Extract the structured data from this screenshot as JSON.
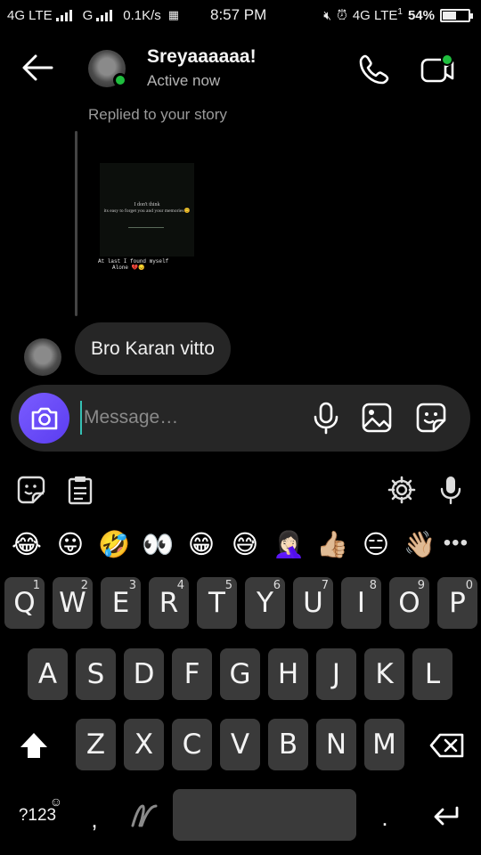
{
  "status_bar": {
    "network1": "4G LTE",
    "network2": "G",
    "speed": "0.1K/s",
    "time": "8:57 PM",
    "network3": "4G LTE",
    "network3_sub": "1",
    "battery": "54%",
    "battery_level": 0.54
  },
  "header": {
    "contact_name": "Sreyaaaaaa!",
    "status": "Active now"
  },
  "chat": {
    "replied_label": "Replied to your story",
    "story": {
      "line1": "I don't think",
      "line2": "its easy to forget you and your memories😊",
      "caption1": "At last I found myself",
      "caption2": "Alone 💔😔"
    },
    "message": "Bro Karan vitto"
  },
  "composer": {
    "placeholder": "Message…"
  },
  "keyboard": {
    "emojis": [
      "😂",
      "😛",
      "🤣",
      "👀",
      "😁",
      "😅",
      "🤦🏻‍♀️",
      "👍🏼",
      "😑",
      "👋🏼"
    ],
    "more": "•••",
    "row1": [
      {
        "key": "Q",
        "hint": "1"
      },
      {
        "key": "W",
        "hint": "2"
      },
      {
        "key": "E",
        "hint": "3"
      },
      {
        "key": "R",
        "hint": "4"
      },
      {
        "key": "T",
        "hint": "5"
      },
      {
        "key": "Y",
        "hint": "6"
      },
      {
        "key": "U",
        "hint": "7"
      },
      {
        "key": "I",
        "hint": "8"
      },
      {
        "key": "O",
        "hint": "9"
      },
      {
        "key": "P",
        "hint": "0"
      }
    ],
    "row2": [
      "A",
      "S",
      "D",
      "F",
      "G",
      "H",
      "J",
      "K",
      "L"
    ],
    "row3": [
      "Z",
      "X",
      "C",
      "V",
      "B",
      "N",
      "M"
    ],
    "symbols_label": "?123",
    "comma": ",",
    "period": "."
  },
  "colors": {
    "accent": "#6b4cf6",
    "online": "#1fbe3e",
    "bubble": "#262626",
    "key": "#3a3a3a"
  }
}
